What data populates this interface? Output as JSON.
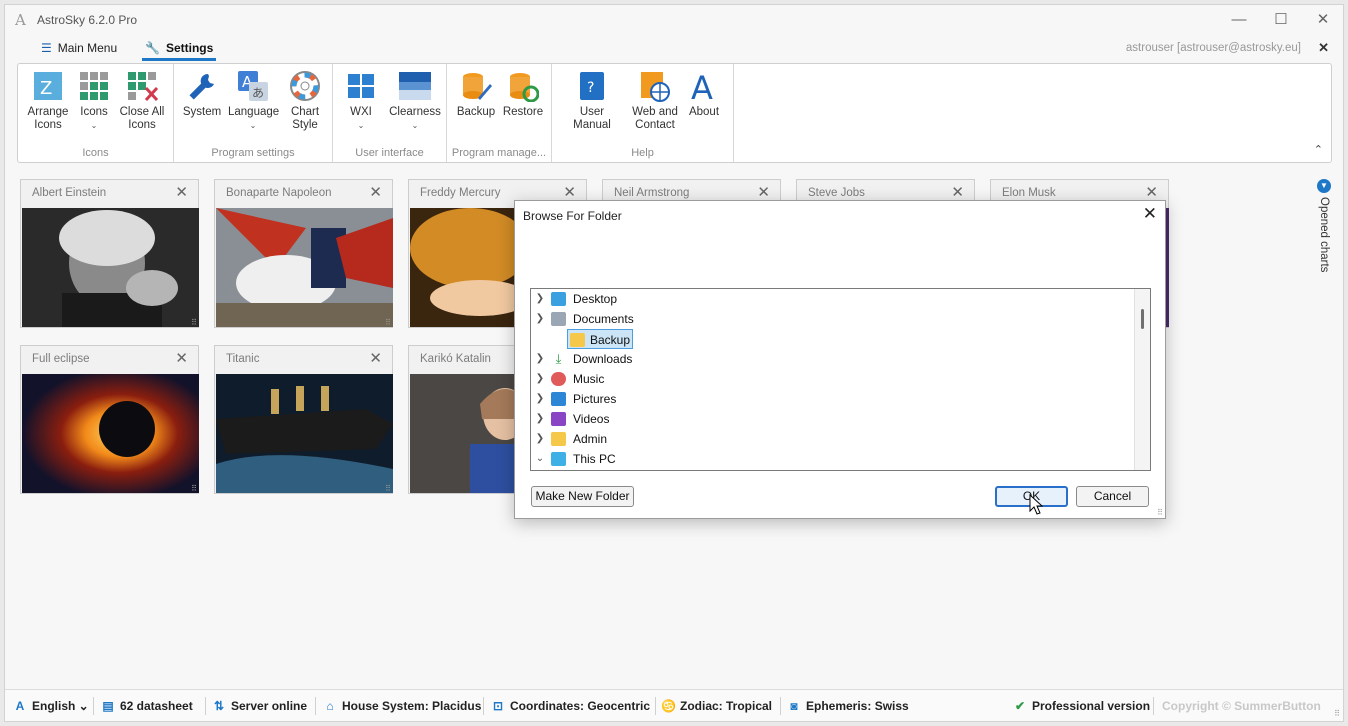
{
  "app": {
    "logo": "A",
    "title": "AstroSky 6.2.0 Pro",
    "minimize": "—",
    "maximize": "☐",
    "close": "✕"
  },
  "menu": {
    "main_menu": "Main Menu",
    "settings": "Settings"
  },
  "user": {
    "label": "astrouser [astrouser@astrosky.eu]",
    "close": "✕"
  },
  "ribbon": {
    "groups": [
      {
        "label": "Icons",
        "buttons": [
          "Arrange Icons",
          "Icons",
          "Close All Icons"
        ]
      },
      {
        "label": "Program settings",
        "buttons": [
          "System",
          "Language",
          "Chart Style"
        ]
      },
      {
        "label": "User interface",
        "buttons": [
          "WXI",
          "Clearness"
        ]
      },
      {
        "label": "Program manage...",
        "buttons": [
          "Backup",
          "Restore"
        ]
      },
      {
        "label": "Help",
        "buttons": [
          "User Manual",
          "Web and Contact",
          "About"
        ]
      }
    ],
    "arrange_l1": "Arrange",
    "arrange_l2": "Icons",
    "icons": "Icons",
    "closeall_l1": "Close All",
    "closeall_l2": "Icons",
    "system": "System",
    "language": "Language",
    "chartstyle_l1": "Chart",
    "chartstyle_l2": "Style",
    "wxi": "WXI",
    "clearness": "Clearness",
    "backup": "Backup",
    "restore": "Restore",
    "manual": "User Manual",
    "web_l1": "Web and",
    "web_l2": "Contact",
    "about": "About",
    "about_glyph": "A",
    "collapse": "⌃"
  },
  "cards": [
    {
      "title": "Albert Einstein"
    },
    {
      "title": "Bonaparte Napoleon"
    },
    {
      "title": "Freddy Mercury"
    },
    {
      "title": "Neil Armstrong"
    },
    {
      "title": "Steve Jobs"
    },
    {
      "title": "Elon Musk"
    },
    {
      "title": "Full eclipse"
    },
    {
      "title": "Titanic"
    },
    {
      "title": "Karikó Katalin"
    }
  ],
  "side_panel": {
    "label": "Opened charts",
    "icon": "▼"
  },
  "dialog": {
    "title": "Browse For Folder",
    "tree": [
      {
        "label": "Desktop",
        "expanded": false
      },
      {
        "label": "Documents",
        "expanded": false
      },
      {
        "label": "Backup",
        "selected": true
      },
      {
        "label": "Downloads",
        "expanded": false
      },
      {
        "label": "Music",
        "expanded": false
      },
      {
        "label": "Pictures",
        "expanded": false
      },
      {
        "label": "Videos",
        "expanded": false
      },
      {
        "label": "Admin",
        "expanded": false
      },
      {
        "label": "This PC",
        "expanded": true
      }
    ],
    "make_new_folder": "Make New Folder",
    "ok": "OK",
    "cancel": "Cancel"
  },
  "status": {
    "language": "English",
    "datasheet": "62 datasheet",
    "server": "Server online",
    "house": "House System: Placidus",
    "coordinates": "Coordinates: Geocentric",
    "zodiac": "Zodiac: Tropical",
    "ephemeris": "Ephemeris: Swiss",
    "version": "Professional version",
    "copyright": "Copyright © SummerButton"
  },
  "colors": {
    "accent": "#1e78c8",
    "selection": "#cce5f6",
    "status_ok": "#2e9a47"
  }
}
